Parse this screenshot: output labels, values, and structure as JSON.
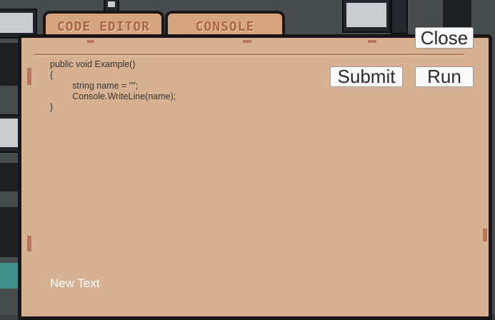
{
  "tabs": [
    {
      "label": "CODE EDITOR"
    },
    {
      "label": "CONSOLE"
    }
  ],
  "buttons": {
    "close": "Close",
    "submit": "Submit",
    "run": "Run"
  },
  "editor": {
    "code": "public void Example()\n{\n         string name = \"\";\n         Console.WriteLine(name);\n}"
  },
  "status_text": "New Text",
  "colors": {
    "panel": "#d6b293",
    "tab": "#d6a47e",
    "tab_text": "#a9674a",
    "border": "#1a1715"
  }
}
